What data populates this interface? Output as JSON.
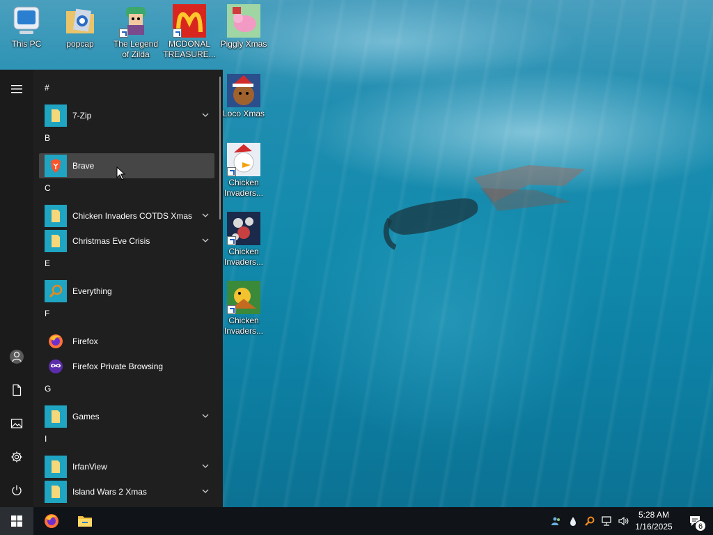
{
  "desktop": {
    "icons": [
      {
        "label": "This PC",
        "icon": "computer-icon"
      },
      {
        "label": "popcap",
        "icon": "folder-icon"
      },
      {
        "label": "The Legend of Zilda",
        "icon": "game-icon"
      },
      {
        "label": "MCDONAL TREASURE...",
        "icon": "game-icon"
      },
      {
        "label": "Piggly Xmas",
        "icon": "game-icon"
      },
      {
        "label": "Loco Xmas",
        "icon": "game-icon"
      },
      {
        "label": "Chicken Invaders...",
        "icon": "game-icon"
      },
      {
        "label": "Chicken Invaders...",
        "icon": "game-icon"
      },
      {
        "label": "Chicken Invaders...",
        "icon": "game-icon"
      }
    ]
  },
  "start_menu": {
    "rail": [
      {
        "name": "expand",
        "icon": "hamburger-icon"
      },
      {
        "name": "account",
        "icon": "user-icon"
      },
      {
        "name": "documents",
        "icon": "document-icon"
      },
      {
        "name": "pictures",
        "icon": "pictures-icon"
      },
      {
        "name": "settings",
        "icon": "gear-icon"
      },
      {
        "name": "power",
        "icon": "power-icon"
      }
    ],
    "groups": [
      {
        "letter": "#",
        "apps": [
          {
            "label": "7-Zip",
            "icon": "folder-icon",
            "expandable": true
          }
        ]
      },
      {
        "letter": "B",
        "apps": [
          {
            "label": "Brave",
            "icon": "brave-icon",
            "expandable": false,
            "hovered": true
          }
        ]
      },
      {
        "letter": "C",
        "apps": [
          {
            "label": "Chicken Invaders COTDS Xmas",
            "icon": "folder-icon",
            "expandable": true
          },
          {
            "label": "Christmas Eve Crisis",
            "icon": "folder-icon",
            "expandable": true
          }
        ]
      },
      {
        "letter": "E",
        "apps": [
          {
            "label": "Everything",
            "icon": "magnifier-icon",
            "expandable": false
          }
        ]
      },
      {
        "letter": "F",
        "apps": [
          {
            "label": "Firefox",
            "icon": "firefox-icon",
            "expandable": false
          },
          {
            "label": "Firefox Private Browsing",
            "icon": "firefox-private-icon",
            "expandable": false
          }
        ]
      },
      {
        "letter": "G",
        "apps": [
          {
            "label": "Games",
            "icon": "folder-icon",
            "expandable": true
          }
        ]
      },
      {
        "letter": "I",
        "apps": [
          {
            "label": "IrfanView",
            "icon": "folder-icon",
            "expandable": true
          },
          {
            "label": "Island Wars 2 Xmas",
            "icon": "folder-icon",
            "expandable": true
          }
        ]
      }
    ]
  },
  "taskbar": {
    "pinned": [
      {
        "name": "firefox",
        "icon": "firefox-icon"
      },
      {
        "name": "file-explorer",
        "icon": "folder-icon"
      }
    ],
    "tray": [
      {
        "name": "network-users",
        "icon": "people-icon"
      },
      {
        "name": "droplet",
        "icon": "droplet-icon"
      },
      {
        "name": "everything",
        "icon": "magnifier-icon"
      },
      {
        "name": "network",
        "icon": "network-icon"
      },
      {
        "name": "volume",
        "icon": "speaker-icon"
      }
    ],
    "time": "5:28 AM",
    "date": "1/16/2025",
    "notification_count": "6"
  },
  "colors": {
    "menu_bg": "#1f1f1f",
    "folder_tile": "#1fa4c2",
    "hover_bg": "#464646",
    "taskbar_bg": "#101418"
  }
}
